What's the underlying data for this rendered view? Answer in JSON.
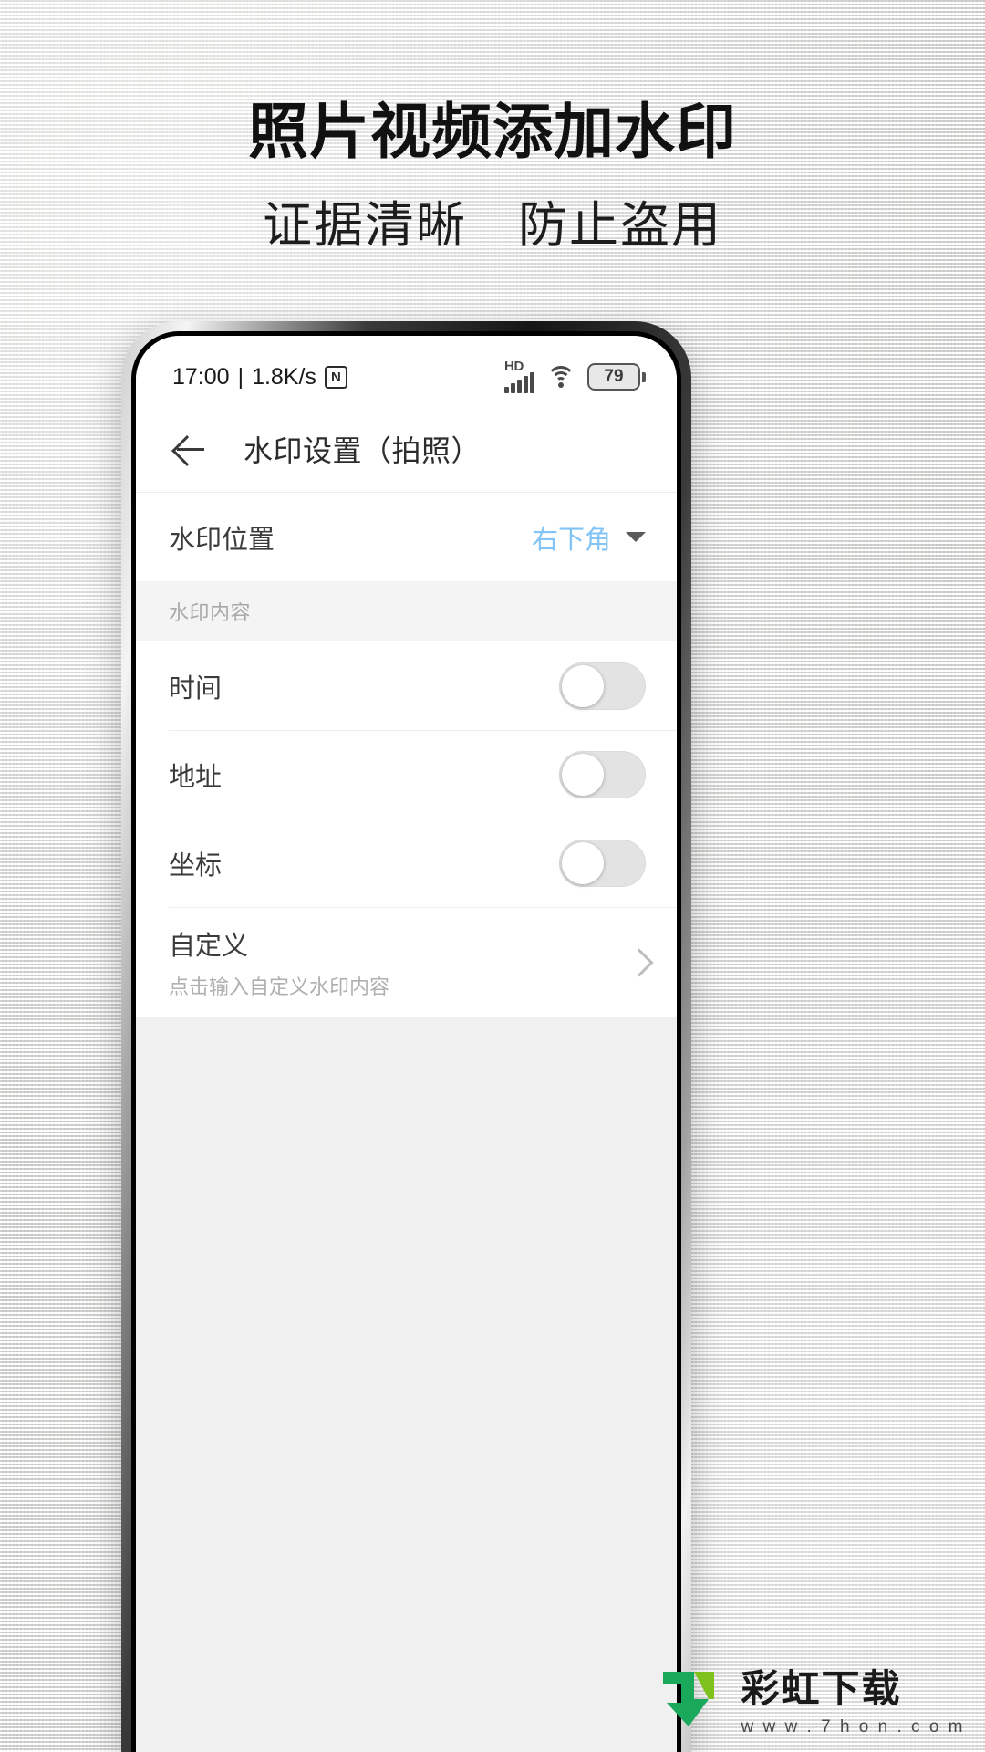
{
  "promo": {
    "headline": "照片视频添加水印",
    "subline": "证据清晰　防止盗用"
  },
  "phone": {
    "status_bar": {
      "time": "17:00",
      "separator": "|",
      "network_speed": "1.8K/s",
      "nfc_icon": "nfc-icon",
      "hd_label": "HD",
      "signal_icon": "signal-bars-icon",
      "wifi_icon": "wifi-icon",
      "battery_level": "79"
    },
    "app_bar": {
      "back_icon": "back-arrow-icon",
      "title": "水印设置（拍照）"
    },
    "settings": {
      "position_row": {
        "label": "水印位置",
        "value": "右下角",
        "dropdown_icon": "chevron-down-icon"
      },
      "section_header": "水印内容",
      "toggle_rows": [
        {
          "label": "时间",
          "state": "off"
        },
        {
          "label": "地址",
          "state": "off"
        },
        {
          "label": "坐标",
          "state": "off"
        }
      ],
      "custom_row": {
        "label": "自定义",
        "sub_label": "点击输入自定义水印内容",
        "chevron_icon": "chevron-right-icon"
      }
    }
  },
  "watermark": {
    "logo_icon": "rainbow-download-logo",
    "title": "彩虹下载",
    "url": "w w w . 7 h o n . c o m"
  },
  "colors": {
    "accent_blue": "#82c4f5",
    "text_primary": "#3b3b3b",
    "text_muted": "#a8a8a8",
    "screen_bg": "#f0f0f0",
    "card_bg": "#ffffff"
  }
}
